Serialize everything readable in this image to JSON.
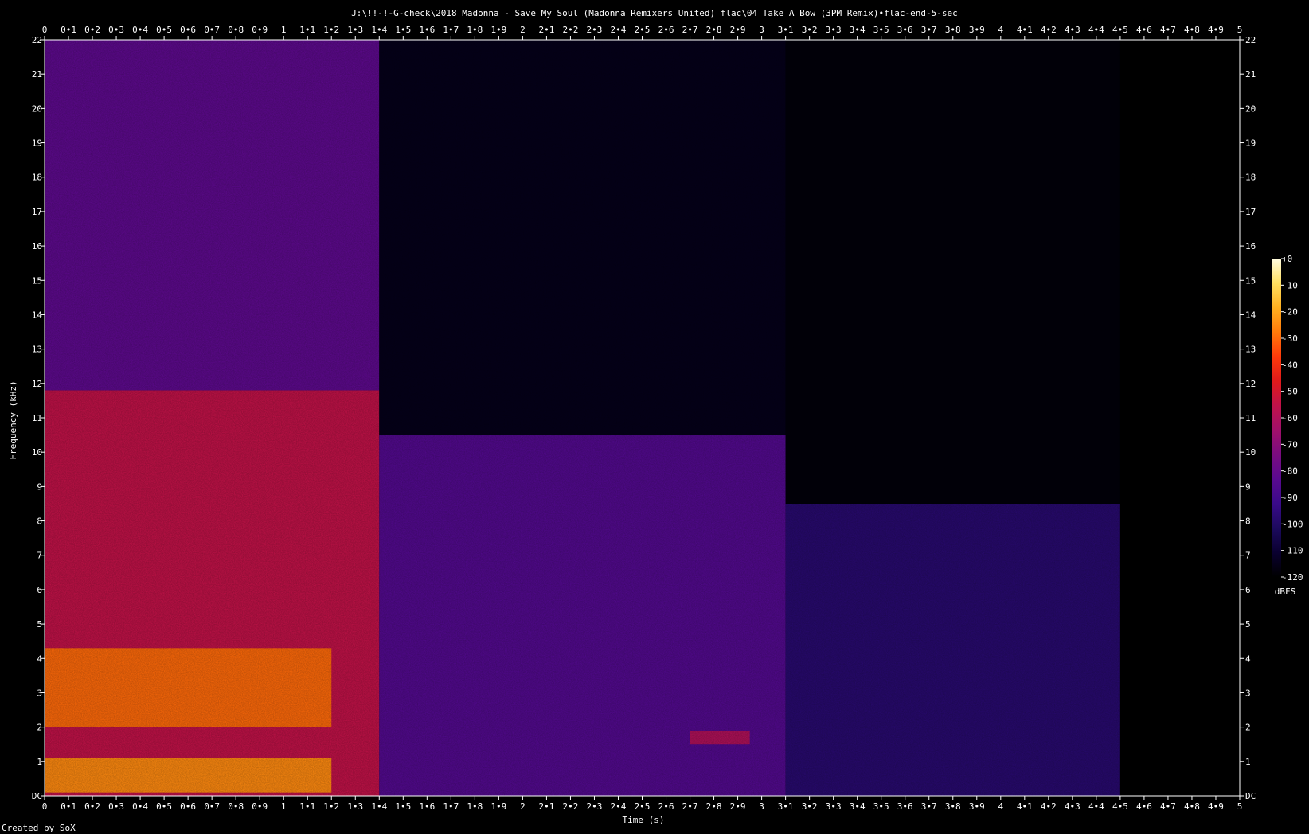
{
  "chart_data": {
    "type": "heatmap",
    "title": "J:\\!!-!-G-check\\2018 Madonna - Save My Soul (Madonna Remixers United) flac\\04 Take A Bow (3PM Remix)•flac-end-5-sec",
    "xlabel": "Time (s)",
    "ylabel": "Frequency (kHz)",
    "xlim": [
      0,
      5
    ],
    "ylim": [
      0,
      22
    ],
    "x_ticks": [
      "0",
      "0•1",
      "0•2",
      "0•3",
      "0•4",
      "0•5",
      "0•6",
      "0•7",
      "0•8",
      "0•9",
      "1",
      "1•1",
      "1•2",
      "1•3",
      "1•4",
      "1•5",
      "1•6",
      "1•7",
      "1•8",
      "1•9",
      "2",
      "2•1",
      "2•2",
      "2•3",
      "2•4",
      "2•5",
      "2•6",
      "2•7",
      "2•8",
      "2•9",
      "3",
      "3•1",
      "3•2",
      "3•3",
      "3•4",
      "3•5",
      "3•6",
      "3•7",
      "3•8",
      "3•9",
      "4",
      "4•1",
      "4•2",
      "4•3",
      "4•4",
      "4•5",
      "4•6",
      "4•7",
      "4•8",
      "4•9",
      "5"
    ],
    "y_ticks": [
      "DC",
      "1",
      "2",
      "3",
      "4",
      "5",
      "6",
      "7",
      "8",
      "9",
      "10",
      "11",
      "12",
      "13",
      "14",
      "15",
      "16",
      "17",
      "18",
      "19",
      "20",
      "21",
      "22"
    ],
    "colorbar": {
      "label": "dBFS",
      "range": [
        -120,
        0
      ],
      "ticks": [
        "+0",
        "-10",
        "-20",
        "-30",
        "-40",
        "-50",
        "-60",
        "-70",
        "-80",
        "-90",
        "-100",
        "-110",
        "-120"
      ],
      "colors": [
        "#000000",
        "#0a0030",
        "#1c0a5e",
        "#3a0a8a",
        "#5a0a90",
        "#7a0c80",
        "#a0106a",
        "#c0124a",
        "#e01a1a",
        "#ff3a0a",
        "#ff7a0a",
        "#ffb020",
        "#ffe060",
        "#fffce0"
      ]
    },
    "regions": [
      {
        "t_start": 0.0,
        "t_end": 1.4,
        "f_low": 0,
        "f_high": 11.8,
        "level_db": -55
      },
      {
        "t_start": 0.0,
        "t_end": 1.4,
        "f_low": 11.8,
        "f_high": 22,
        "level_db": -82
      },
      {
        "t_start": 0.0,
        "t_end": 1.2,
        "f_low": 2,
        "f_high": 4.3,
        "level_db": -30
      },
      {
        "t_start": 0.0,
        "t_end": 1.2,
        "f_low": 0.1,
        "f_high": 1.1,
        "level_db": -25
      },
      {
        "t_start": 1.4,
        "t_end": 3.1,
        "f_low": 0,
        "f_high": 10.5,
        "level_db": -85
      },
      {
        "t_start": 1.4,
        "t_end": 3.1,
        "f_low": 10.5,
        "f_high": 22,
        "level_db": -115
      },
      {
        "t_start": 2.7,
        "t_end": 2.95,
        "f_low": 1.5,
        "f_high": 1.9,
        "level_db": -60
      },
      {
        "t_start": 3.1,
        "t_end": 4.5,
        "f_low": 0,
        "f_high": 8.5,
        "level_db": -98
      },
      {
        "t_start": 3.1,
        "t_end": 4.5,
        "f_low": 8.5,
        "f_high": 22,
        "level_db": -118
      },
      {
        "t_start": 4.5,
        "t_end": 5.0,
        "f_low": 0,
        "f_high": 22,
        "level_db": -120
      }
    ],
    "grid": false
  },
  "footer": {
    "credit": "Created by SoX"
  }
}
